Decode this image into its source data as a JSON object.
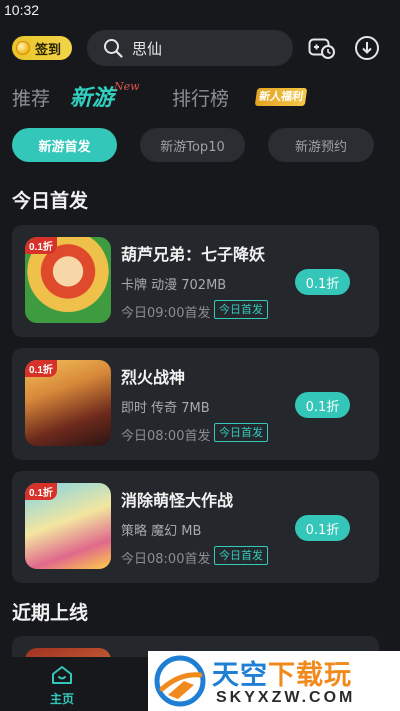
{
  "status_bar": {
    "time": "10:32"
  },
  "header": {
    "checkin_label": "签到",
    "search_value": "思仙"
  },
  "tabs": [
    {
      "label": "推荐"
    },
    {
      "label": "新游",
      "tag": "New"
    },
    {
      "label": "排行榜"
    },
    {
      "label": "新人福利"
    }
  ],
  "subtabs": [
    {
      "label": "新游首发",
      "selected": true
    },
    {
      "label": "新游Top10",
      "selected": false
    },
    {
      "label": "新游预约",
      "selected": false
    }
  ],
  "sections": {
    "today": "今日首发",
    "soon": "近期上线"
  },
  "games": [
    {
      "thumb_tag": "0.1折",
      "title": "葫芦兄弟：七子降妖",
      "tags": "卡牌 动漫 702MB",
      "time": "今日09:00首发",
      "badge": "今日首发",
      "discount": "0.1折"
    },
    {
      "thumb_tag": "0.1折",
      "title": "烈火战神",
      "tags": "即时 传奇 7MB",
      "time": "今日08:00首发",
      "badge": "今日首发",
      "discount": "0.1折"
    },
    {
      "thumb_tag": "0.1折",
      "title": "消除萌怪大作战",
      "tags": "策略 魔幻 MB",
      "time": "今日08:00首发",
      "badge": "今日首发",
      "discount": "0.1折"
    }
  ],
  "bottom_nav": {
    "home_label": "主页"
  },
  "watermark": {
    "title_a": "天空",
    "title_b": "下载玩",
    "domain": "SKYXZW.COM"
  },
  "colors": {
    "accent": "#33c7b9",
    "background": "#16181b",
    "card": "#24272b",
    "checkin": "#e9c32a"
  }
}
